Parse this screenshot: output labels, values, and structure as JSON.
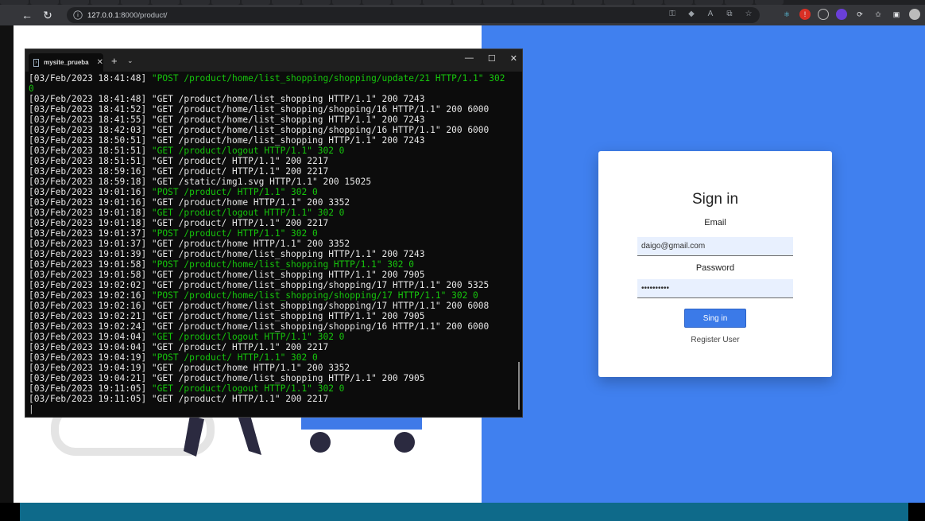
{
  "browser": {
    "url_host": "127.0.0.1",
    "url_rest": ":8000/product/"
  },
  "terminal": {
    "tab_title": "mysite_prueba",
    "lines": [
      {
        "ts": "[03/Feb/2023 18:41:48]",
        "req": " \"POST /product/home/list_shopping/shopping/update/21 HTTP/1.1\" 302",
        "green": true
      },
      {
        "ts": "0",
        "req": "",
        "green": true
      },
      {
        "ts": "[03/Feb/2023 18:41:48]",
        "req": " \"GET /product/home/list_shopping HTTP/1.1\" 200 7243",
        "green": false
      },
      {
        "ts": "[03/Feb/2023 18:41:52]",
        "req": " \"GET /product/home/list_shopping/shopping/16 HTTP/1.1\" 200 6000",
        "green": false
      },
      {
        "ts": "[03/Feb/2023 18:41:55]",
        "req": " \"GET /product/home/list_shopping HTTP/1.1\" 200 7243",
        "green": false
      },
      {
        "ts": "[03/Feb/2023 18:42:03]",
        "req": " \"GET /product/home/list_shopping/shopping/16 HTTP/1.1\" 200 6000",
        "green": false
      },
      {
        "ts": "[03/Feb/2023 18:50:51]",
        "req": " \"GET /product/home/list_shopping HTTP/1.1\" 200 7243",
        "green": false
      },
      {
        "ts": "[03/Feb/2023 18:51:51]",
        "req": " \"GET /product/logout HTTP/1.1\" 302 0",
        "green": true
      },
      {
        "ts": "[03/Feb/2023 18:51:51]",
        "req": " \"GET /product/ HTTP/1.1\" 200 2217",
        "green": false
      },
      {
        "ts": "[03/Feb/2023 18:59:16]",
        "req": " \"GET /product/ HTTP/1.1\" 200 2217",
        "green": false
      },
      {
        "ts": "[03/Feb/2023 18:59:18]",
        "req": " \"GET /static/img1.svg HTTP/1.1\" 200 15025",
        "green": false
      },
      {
        "ts": "[03/Feb/2023 19:01:16]",
        "req": " \"POST /product/ HTTP/1.1\" 302 0",
        "green": true
      },
      {
        "ts": "[03/Feb/2023 19:01:16]",
        "req": " \"GET /product/home HTTP/1.1\" 200 3352",
        "green": false
      },
      {
        "ts": "[03/Feb/2023 19:01:18]",
        "req": " \"GET /product/logout HTTP/1.1\" 302 0",
        "green": true
      },
      {
        "ts": "[03/Feb/2023 19:01:18]",
        "req": " \"GET /product/ HTTP/1.1\" 200 2217",
        "green": false
      },
      {
        "ts": "[03/Feb/2023 19:01:37]",
        "req": " \"POST /product/ HTTP/1.1\" 302 0",
        "green": true
      },
      {
        "ts": "[03/Feb/2023 19:01:37]",
        "req": " \"GET /product/home HTTP/1.1\" 200 3352",
        "green": false
      },
      {
        "ts": "[03/Feb/2023 19:01:39]",
        "req": " \"GET /product/home/list_shopping HTTP/1.1\" 200 7243",
        "green": false
      },
      {
        "ts": "[03/Feb/2023 19:01:58]",
        "req": " \"POST /product/home/list_shopping HTTP/1.1\" 302 0",
        "green": true
      },
      {
        "ts": "[03/Feb/2023 19:01:58]",
        "req": " \"GET /product/home/list_shopping HTTP/1.1\" 200 7905",
        "green": false
      },
      {
        "ts": "[03/Feb/2023 19:02:02]",
        "req": " \"GET /product/home/list_shopping/shopping/17 HTTP/1.1\" 200 5325",
        "green": false
      },
      {
        "ts": "[03/Feb/2023 19:02:16]",
        "req": " \"POST /product/home/list_shopping/shopping/17 HTTP/1.1\" 302 0",
        "green": true
      },
      {
        "ts": "[03/Feb/2023 19:02:16]",
        "req": " \"GET /product/home/list_shopping/shopping/17 HTTP/1.1\" 200 6008",
        "green": false
      },
      {
        "ts": "[03/Feb/2023 19:02:21]",
        "req": " \"GET /product/home/list_shopping HTTP/1.1\" 200 7905",
        "green": false
      },
      {
        "ts": "[03/Feb/2023 19:02:24]",
        "req": " \"GET /product/home/list_shopping/shopping/16 HTTP/1.1\" 200 6000",
        "green": false
      },
      {
        "ts": "[03/Feb/2023 19:04:04]",
        "req": " \"GET /product/logout HTTP/1.1\" 302 0",
        "green": true
      },
      {
        "ts": "[03/Feb/2023 19:04:04]",
        "req": " \"GET /product/ HTTP/1.1\" 200 2217",
        "green": false
      },
      {
        "ts": "[03/Feb/2023 19:04:19]",
        "req": " \"POST /product/ HTTP/1.1\" 302 0",
        "green": true
      },
      {
        "ts": "[03/Feb/2023 19:04:19]",
        "req": " \"GET /product/home HTTP/1.1\" 200 3352",
        "green": false
      },
      {
        "ts": "[03/Feb/2023 19:04:21]",
        "req": " \"GET /product/home/list_shopping HTTP/1.1\" 200 7905",
        "green": false
      },
      {
        "ts": "[03/Feb/2023 19:11:05]",
        "req": " \"GET /product/logout HTTP/1.1\" 302 0",
        "green": true
      },
      {
        "ts": "[03/Feb/2023 19:11:05]",
        "req": " \"GET /product/ HTTP/1.1\" 200 2217",
        "green": false
      }
    ]
  },
  "signin": {
    "title": "Sign in",
    "email_label": "Email",
    "email_value": "daigo@gmail.com",
    "password_label": "Password",
    "password_value": "••••••••••",
    "submit_label": "Sing in",
    "register_link": "Register User"
  },
  "colors": {
    "right_panel": "#4080ef",
    "footer": "#0e6a8a",
    "terminal_green": "#16c60c"
  }
}
